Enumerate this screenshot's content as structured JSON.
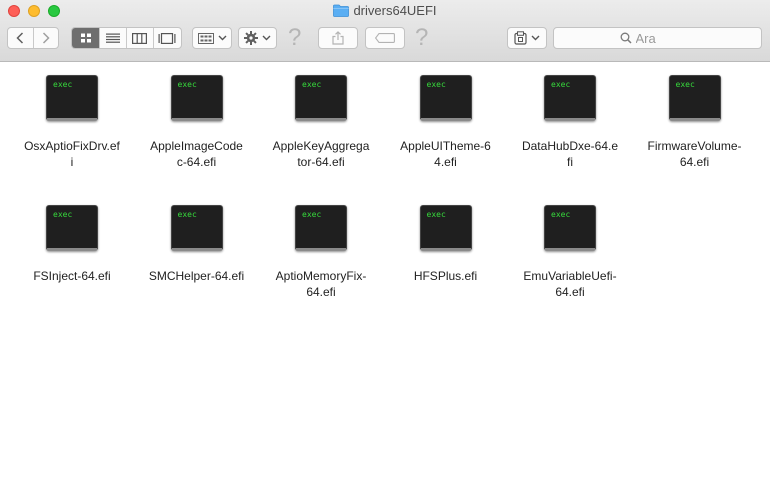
{
  "window": {
    "title": "drivers64UEFI"
  },
  "search": {
    "placeholder": "Ara"
  },
  "icons": {
    "folder": "folder-icon",
    "exec_label": "exec"
  },
  "colors": {
    "close": "#fe5f57",
    "minimize": "#febc2e",
    "maximize": "#28c840",
    "exec_text": "#36d93c"
  },
  "files": [
    {
      "name": "OsxAptioFixDrv.efi",
      "lines": [
        "OsxAptioFixDrv.ef",
        "i"
      ]
    },
    {
      "name": "AppleImageCodec-64.efi",
      "lines": [
        "AppleImageCode",
        "c-64.efi"
      ]
    },
    {
      "name": "AppleKeyAggregator-64.efi",
      "lines": [
        "AppleKeyAggrega",
        "tor-64.efi"
      ]
    },
    {
      "name": "AppleUITheme-64.efi",
      "lines": [
        "AppleUITheme-6",
        "4.efi"
      ]
    },
    {
      "name": "DataHubDxe-64.efi",
      "lines": [
        "DataHubDxe-64.e",
        "fi"
      ]
    },
    {
      "name": "FirmwareVolume-64.efi",
      "lines": [
        "FirmwareVolume-",
        "64.efi"
      ]
    },
    {
      "name": "FSInject-64.efi",
      "lines": [
        "FSInject-64.efi"
      ]
    },
    {
      "name": "SMCHelper-64.efi",
      "lines": [
        "SMCHelper-64.efi"
      ]
    },
    {
      "name": "AptioMemoryFix-64.efi",
      "lines": [
        "AptioMemoryFix-",
        "64.efi"
      ]
    },
    {
      "name": "HFSPlus.efi",
      "lines": [
        "HFSPlus.efi"
      ]
    },
    {
      "name": "EmuVariableUefi-64.efi",
      "lines": [
        "EmuVariableUefi-",
        "64.efi"
      ]
    }
  ]
}
